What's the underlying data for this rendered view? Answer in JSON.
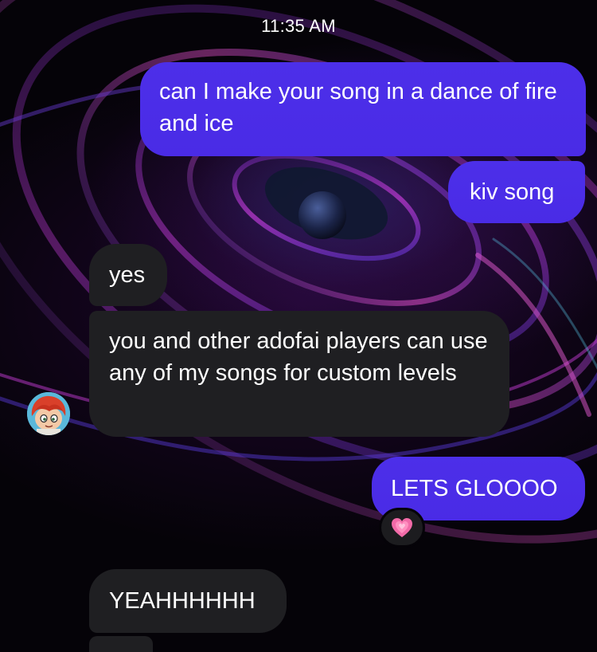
{
  "status_bar": {
    "time": "11:35 AM"
  },
  "messages": [
    {
      "direction": "sent",
      "text": "can I make your song in a dance of fire and ice"
    },
    {
      "direction": "sent",
      "text": "kiv song"
    },
    {
      "direction": "received",
      "text": "yes"
    },
    {
      "direction": "received",
      "text": "you and other adofai players can use any of my songs for custom levels"
    },
    {
      "direction": "sent",
      "text": "LETS GLOOOO",
      "reaction": {
        "icon": "growing-heart-emoji-icon"
      }
    },
    {
      "direction": "received",
      "text": "YEAHHHHHH"
    }
  ],
  "avatar": {
    "icon": "cartoon-avatar-icon"
  },
  "colors": {
    "sent_bubble": "#4a2be6",
    "received_bubble": "#1f1f22",
    "background": "#050308",
    "text": "#ffffff"
  }
}
